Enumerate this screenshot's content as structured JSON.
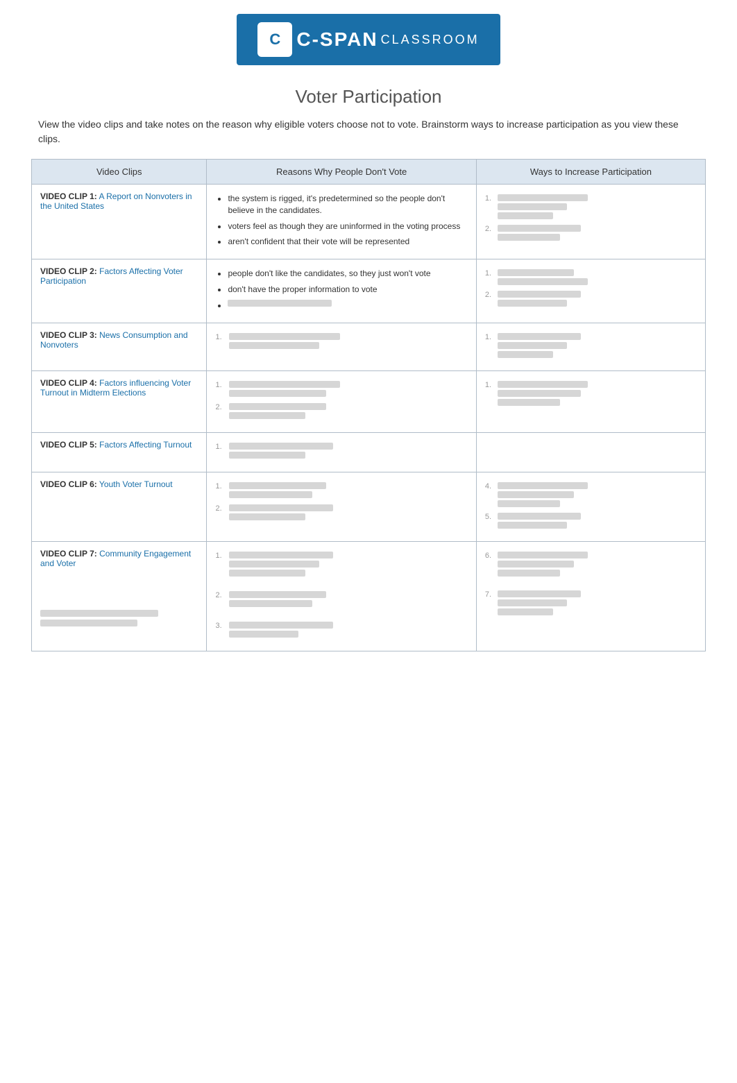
{
  "header": {
    "logo_text": "C-SPAN",
    "logo_sub": "CLASSROOM"
  },
  "page": {
    "title": "Voter Participation",
    "intro": "View the video clips and take notes on the reason why eligible voters choose not to vote. Brainstorm ways to increase participation as you view these clips."
  },
  "table": {
    "col1_header": "Video Clips",
    "col2_header": "Reasons Why People Don't Vote",
    "col3_header": "Ways to Increase Participation",
    "rows": [
      {
        "clip_label": "VIDEO CLIP 1:",
        "clip_link": "A Report on Nonvoters in the United States",
        "reasons_visible": [
          "the system is rigged, it's predetermined so the people don't believe in the candidates.",
          "voters feel as though they are uninformed in the voting process",
          "aren't confident that their vote will be represented"
        ],
        "has_blurred_ways": true
      },
      {
        "clip_label": "VIDEO CLIP 2:",
        "clip_link": "Factors Affecting Voter Participation",
        "reasons_visible": [
          "people don't like the candidates, so they just won't vote",
          "don't have the proper information to vote"
        ],
        "reasons_blurred": true,
        "has_blurred_ways": true
      },
      {
        "clip_label": "VIDEO CLIP 3:",
        "clip_link": "News Consumption and Nonvoters",
        "reasons_blurred_only": true,
        "has_blurred_ways": true
      },
      {
        "clip_label": "VIDEO CLIP 4:",
        "clip_link": "Factors influencing Voter Turnout in Midterm Elections",
        "reasons_blurred_only": true,
        "has_blurred_ways": true
      },
      {
        "clip_label": "VIDEO CLIP 5:",
        "clip_link": "Factors Affecting Turnout",
        "reasons_blurred_only": true,
        "has_blurred_ways": false
      },
      {
        "clip_label": "VIDEO CLIP 6:",
        "clip_link": "Youth Voter Turnout",
        "reasons_blurred_only": true,
        "has_blurred_ways": true
      },
      {
        "clip_label": "VIDEO CLIP 7:",
        "clip_link": "Community Engagement and Voter",
        "reasons_blurred_only": true,
        "has_blurred_ways": true,
        "extra_content": true
      }
    ]
  }
}
